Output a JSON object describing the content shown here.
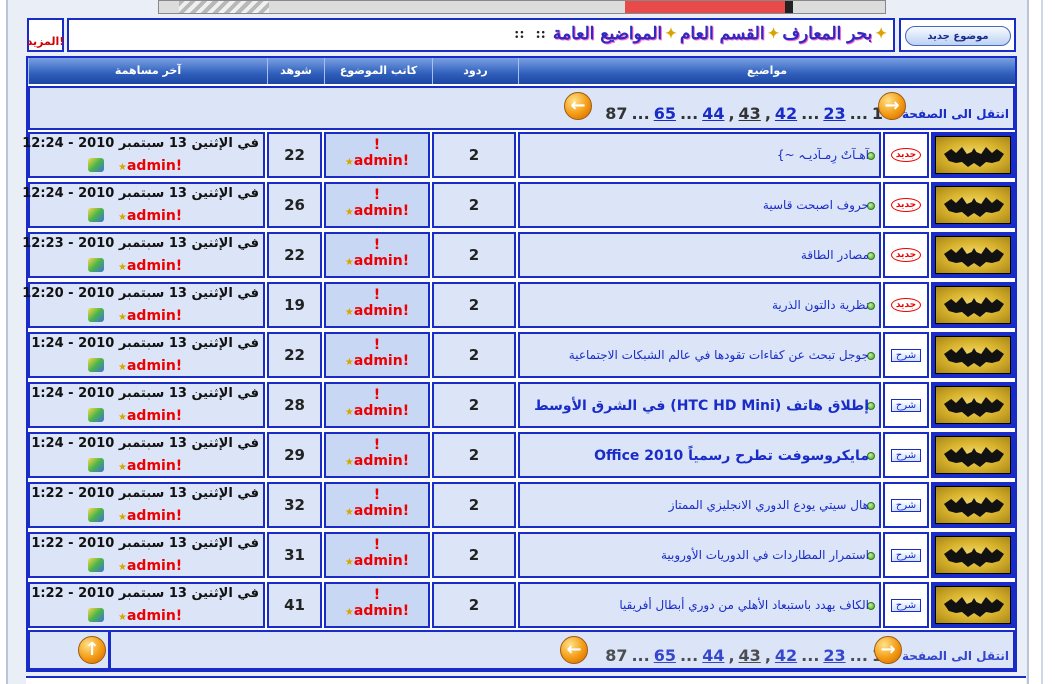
{
  "header": {
    "more_label": "المزيد!",
    "new_topic_label": "موضوع جديد",
    "breadcrumb": [
      "بحر المعارف",
      "القسم العام",
      "المواضيع العامة"
    ],
    "breadcrumb_sep": "::"
  },
  "table": {
    "columns": {
      "topics": "مواضيع",
      "replies": "ردود",
      "author": "كاتب الموضوع",
      "views": "شوهد",
      "last_post": "آخر مساهمة"
    }
  },
  "pager": {
    "label": "انتقل الى الصفحة :",
    "current": "1",
    "pages": [
      "23",
      "42",
      "43",
      "44",
      "65",
      "87"
    ],
    "ellipsis": "..."
  },
  "topics": [
    {
      "status": "جديد",
      "title": "آهـآتٌ رِمـآديـہ ~}",
      "replies": "2",
      "author_mark": "!",
      "author": "admin!",
      "views": "22",
      "last_date": "في الإثنين 13 سبتمبر 2010 - 12:24",
      "last_author": "admin!"
    },
    {
      "status": "جديد",
      "title": "حروف اصبحت قاسية",
      "replies": "2",
      "author_mark": "!",
      "author": "admin!",
      "views": "26",
      "last_date": "في الإثنين 13 سبتمبر 2010 - 12:24",
      "last_author": "admin!"
    },
    {
      "status": "جديد",
      "title": "مصادر الطاقة",
      "replies": "2",
      "author_mark": "!",
      "author": "admin!",
      "views": "22",
      "last_date": "في الإثنين 13 سبتمبر 2010 - 12:23",
      "last_author": "admin!"
    },
    {
      "status": "جديد",
      "title": "نظرية دالتون الذرية",
      "replies": "2",
      "author_mark": "!",
      "author": "admin!",
      "views": "19",
      "last_date": "في الإثنين 13 سبتمبر 2010 - 12:20",
      "last_author": "admin!"
    },
    {
      "status": "شرح",
      "title": "جوجل تبحث عن كفاءات تقودها في عالم الشبكات الاجتماعية",
      "replies": "2",
      "author_mark": "!",
      "author": "admin!",
      "views": "22",
      "last_date": "في الإثنين 13 سبتمبر 2010 - 1:24",
      "last_author": "admin!"
    },
    {
      "status": "شرح",
      "title": "إطلاق هاتف (HTC HD Mini) في الشرق الأوسط",
      "replies": "2",
      "author_mark": "!",
      "author": "admin!",
      "views": "28",
      "last_date": "في الإثنين 13 سبتمبر 2010 - 1:24",
      "last_author": "admin!"
    },
    {
      "status": "شرح",
      "title": "مايكروسوفت تطرح رسمياً Office 2010",
      "replies": "2",
      "author_mark": "!",
      "author": "admin!",
      "views": "29",
      "last_date": "في الإثنين 13 سبتمبر 2010 - 1:24",
      "last_author": "admin!"
    },
    {
      "status": "شرح",
      "title": "هال سيتي يودع الدوري الانجليزي الممتاز",
      "replies": "2",
      "author_mark": "!",
      "author": "admin!",
      "views": "32",
      "last_date": "في الإثنين 13 سبتمبر 2010 - 1:22",
      "last_author": "admin!"
    },
    {
      "status": "شرح",
      "title": "استمرار المطاردات في الدوريات الأوروبية",
      "replies": "2",
      "author_mark": "!",
      "author": "admin!",
      "views": "31",
      "last_date": "في الإثنين 13 سبتمبر 2010 - 1:22",
      "last_author": "admin!"
    },
    {
      "status": "شرح",
      "title": "الكاف يهدد باستبعاد الأهلي من دوري أبطال أفريقيا",
      "replies": "2",
      "author_mark": "!",
      "author": "admin!",
      "views": "41",
      "last_date": "في الإثنين 13 سبتمبر 2010 - 1:22",
      "last_author": "admin!"
    }
  ],
  "colors": {
    "border": "#1a2cc8",
    "header_gradient": "#2f5fbc",
    "row_bg": "#dbe5f7",
    "author_bg": "#c8d7f4",
    "alert": "#e00000"
  }
}
